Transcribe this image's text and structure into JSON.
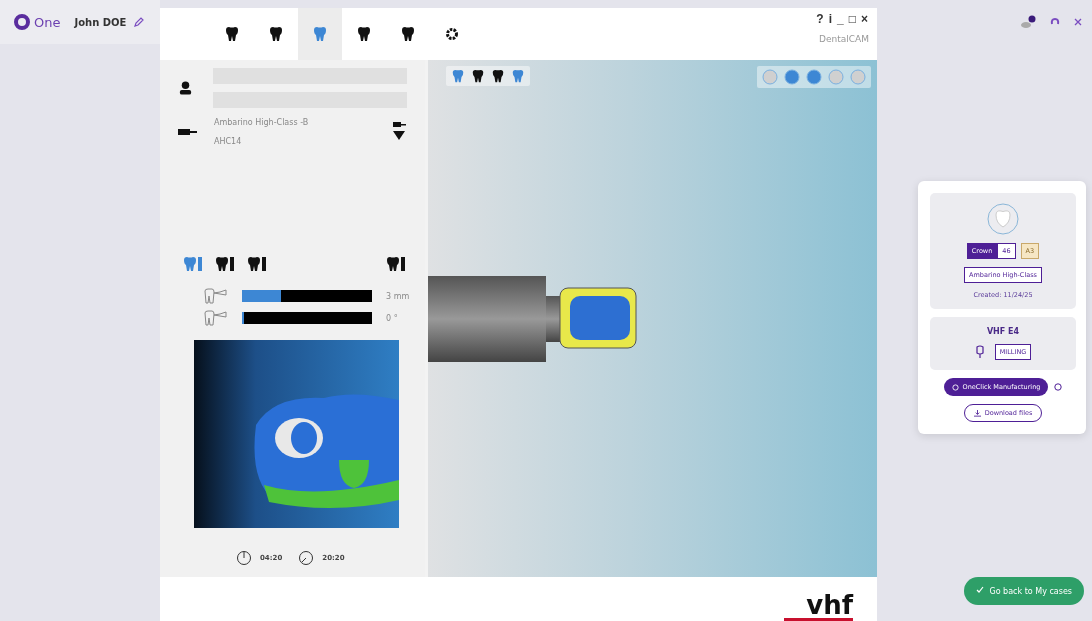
{
  "app": {
    "logo": "One",
    "user": "John DOE"
  },
  "toolbar": {
    "tools": [
      {
        "selected": false
      },
      {
        "selected": false
      },
      {
        "selected": true
      },
      {
        "selected": false
      },
      {
        "selected": false
      },
      {
        "selected": false
      }
    ],
    "window_controls": [
      "?",
      "i",
      "_",
      "□",
      "×"
    ],
    "product": "DentalCAM"
  },
  "left_panel": {
    "tool_name": "Ambarino High-Class -B",
    "tool_code": "AHC14",
    "tooth_tabs": [
      {
        "selected": true
      },
      {
        "selected": false
      },
      {
        "selected": false
      },
      {
        "selected": false
      }
    ],
    "sliders": [
      {
        "level": 0.3,
        "reading": "3 mm"
      },
      {
        "level": 0,
        "reading": "0 °"
      }
    ],
    "times": [
      "04:20",
      "20:20"
    ]
  },
  "viewport": {
    "left_tools": [
      {
        "selected": true
      },
      {
        "selected": false
      },
      {
        "selected": false
      },
      {
        "selected": true
      }
    ],
    "right_tools": [
      {
        "selected": false
      },
      {
        "selected": true
      },
      {
        "selected": true
      },
      {
        "selected": false
      },
      {
        "selected": false
      }
    ]
  },
  "case_card": {
    "type": "Crown",
    "tooth": "46",
    "shade": "A3",
    "material": "Ambarino High-Class",
    "created": "Created: 11/24/25",
    "machine": "VHF E4",
    "process": "MILLING",
    "primary_action": "OneClick Manufacturing",
    "secondary_action": "Download files"
  },
  "back_button": "Go back to My cases",
  "brand": "vhf"
}
